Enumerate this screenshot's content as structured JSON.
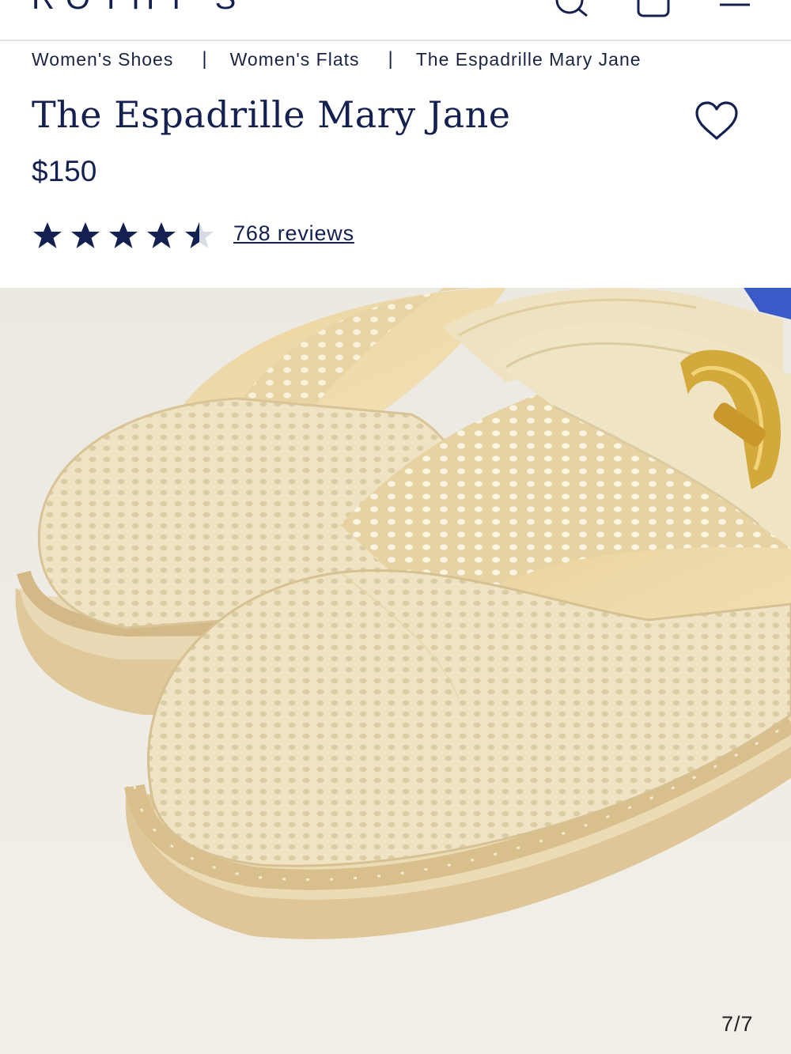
{
  "header": {
    "logo": "ROTHY'S",
    "icons": [
      "search-icon",
      "bag-icon",
      "menu-icon"
    ]
  },
  "breadcrumb": {
    "items": [
      "Women's Shoes",
      "Women's Flats",
      "The Espadrille Mary Jane"
    ],
    "separator": "|"
  },
  "product": {
    "title": "The Espadrille Mary Jane",
    "price": "$150",
    "rating": 4.5,
    "rating_max": 5,
    "reviews_label": "768 reviews"
  },
  "gallery": {
    "counter": "7/7"
  },
  "colors": {
    "navy": "#142050",
    "background": "#efece6",
    "shoe": "#eee1bf",
    "sole": "#dcc497",
    "buckle": "#d4a93c"
  }
}
